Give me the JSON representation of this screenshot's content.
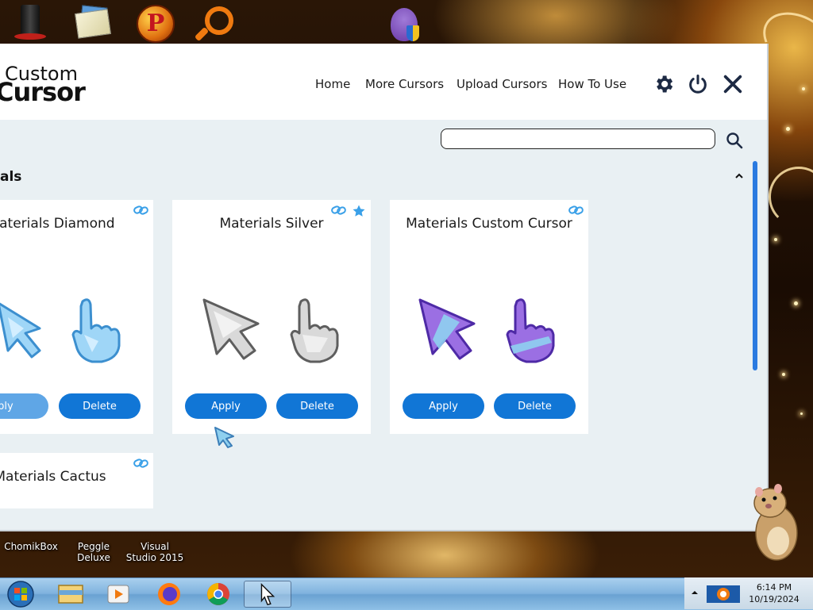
{
  "app": {
    "logo": {
      "line1": "Custom",
      "line2": "Cursor"
    },
    "nav": {
      "home": "Home",
      "more_cursors": "More Cursors",
      "upload_cursors": "Upload Cursors",
      "how_to_use": "How To Use"
    },
    "search": {
      "value": "",
      "placeholder": ""
    },
    "section": {
      "title": "als"
    },
    "cards": [
      {
        "title": "Materials Diamond",
        "apply": "Apply",
        "delete": "Delete"
      },
      {
        "title": "Materials Silver",
        "apply": "Apply",
        "delete": "Delete"
      },
      {
        "title": "Materials Custom Cursor",
        "apply": "Apply",
        "delete": "Delete"
      },
      {
        "title": "Materials Cactus"
      }
    ],
    "colors": {
      "accent": "#1176d6",
      "background": "#e9f0f3"
    }
  },
  "desktop": {
    "icons": [
      "ChomikBox",
      "Peggle Deluxe",
      "Visual Studio 2015"
    ]
  },
  "taskbar": {
    "time": "6:14 PM",
    "date": "10/19/2024"
  }
}
